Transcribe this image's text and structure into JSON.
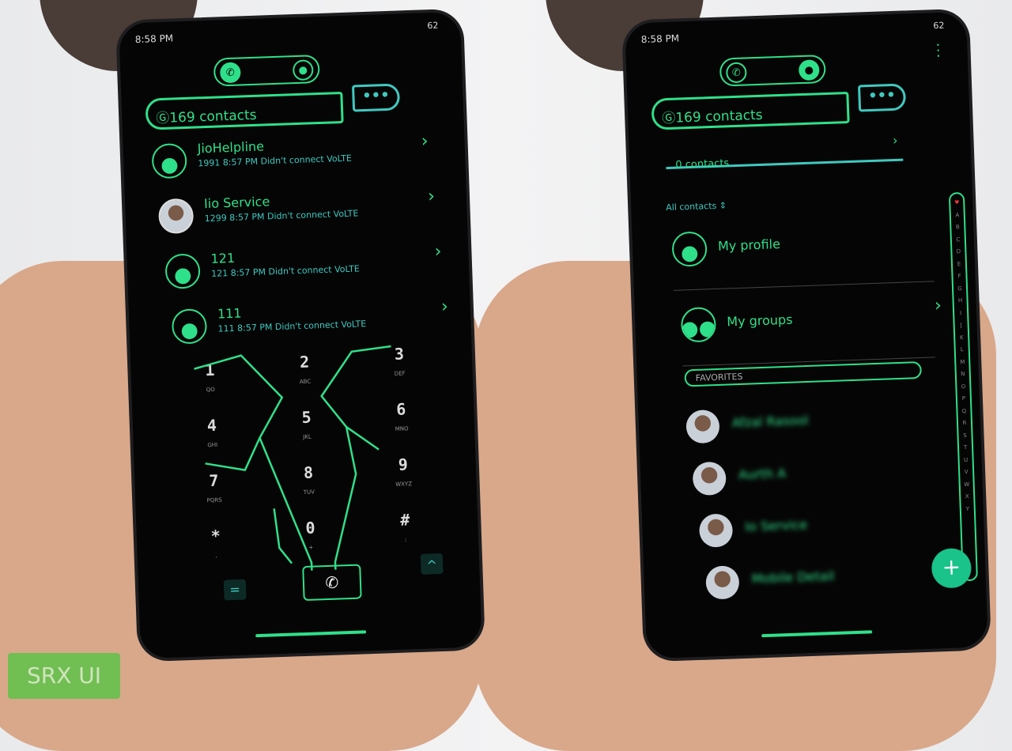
{
  "status": {
    "time": "8:58 PM",
    "battery": "62"
  },
  "dialer": {
    "search_label": "169 contacts",
    "more_label": "•••",
    "recents": [
      {
        "name": "JioHelpline",
        "detail": "1991 8:57 PM Didn't connect VoLTE",
        "avatar": "person-icon"
      },
      {
        "name": "Iio Service",
        "detail": "1299 8:57 PM Didn't connect VoLTE",
        "avatar": "photo"
      },
      {
        "name": "121",
        "detail": "121 8:57 PM Didn't connect VoLTE",
        "avatar": "person-icon"
      },
      {
        "name": "111",
        "detail": "111 8:57 PM Didn't connect VoLTE",
        "avatar": "person-icon"
      }
    ],
    "keys": [
      {
        "d": "1",
        "l": "QO"
      },
      {
        "d": "2",
        "l": "ABC"
      },
      {
        "d": "3",
        "l": "DEF"
      },
      {
        "d": "4",
        "l": "GHI"
      },
      {
        "d": "5",
        "l": "JKL"
      },
      {
        "d": "6",
        "l": "MNO"
      },
      {
        "d": "7",
        "l": "PQRS"
      },
      {
        "d": "8",
        "l": "TUV"
      },
      {
        "d": "9",
        "l": "WXYZ"
      },
      {
        "d": "*",
        "l": ","
      },
      {
        "d": "0",
        "l": "+"
      },
      {
        "d": "#",
        "l": ";"
      }
    ],
    "menu_glyph": "=",
    "collapse_glyph": "^"
  },
  "contacts": {
    "search_label": "169 contacts",
    "more_label": "•••",
    "account_label": "0 contacts",
    "filter_label": "All contacts",
    "my_profile": "My profile",
    "my_groups": "My groups",
    "favorites_header": "FAVORITES",
    "favorites": [
      "Afzal Rasool",
      "Aurth A",
      "Io Service",
      "Mobile Detail"
    ],
    "index": [
      "A",
      "B",
      "C",
      "D",
      "E",
      "F",
      "G",
      "H",
      "I",
      "J",
      "K",
      "L",
      "M",
      "N",
      "O",
      "P",
      "Q",
      "R",
      "S",
      "T",
      "U",
      "V",
      "W",
      "X",
      "Y"
    ],
    "fab": "+"
  },
  "watermark": "SRX UI",
  "colors": {
    "accent": "#2fe08a",
    "teal": "#3fc9c0",
    "fab": "#19c389"
  }
}
